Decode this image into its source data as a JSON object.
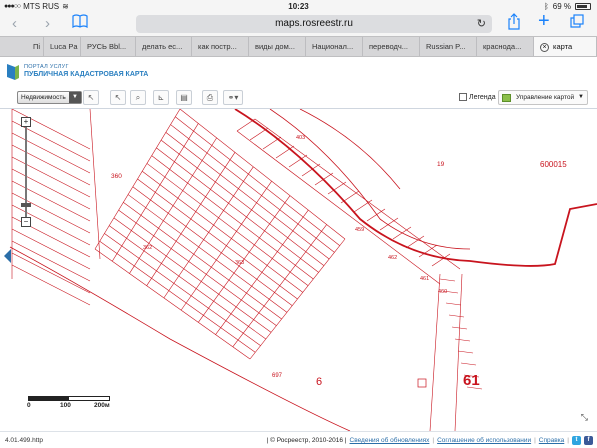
{
  "status_bar": {
    "carrier": "MTS RUS",
    "time": "10:23",
    "battery_text": "69 %",
    "battery_level": 0.69
  },
  "browser": {
    "url": "maps.rosreestr.ru",
    "tabs": [
      {
        "label": "Пі"
      },
      {
        "label": "Luca Pa"
      },
      {
        "label": "РУСЬ Bbl..."
      },
      {
        "label": "делать ес..."
      },
      {
        "label": "как постр..."
      },
      {
        "label": "виды дом..."
      },
      {
        "label": "Национал..."
      },
      {
        "label": "переводч..."
      },
      {
        "label": "Russian P..."
      },
      {
        "label": "краснода..."
      },
      {
        "label": "карта"
      }
    ]
  },
  "portal": {
    "small_title": "ПОРТАЛ УСЛУГ",
    "big_title": "ПУБЛИЧНАЯ КАДАСТРОВАЯ КАРТА"
  },
  "toolbar": {
    "realty_label": "Недвижимость",
    "legend_label": "Легенда",
    "manage_label": "Управление картой"
  },
  "map": {
    "labels": {
      "l360": "360",
      "l19": "19",
      "l600015": "600015",
      "l61": "61",
      "l6": "6",
      "l697": "697",
      "l461": "461",
      "l462": "462",
      "l460": "460",
      "l459": "459",
      "l403": "403",
      "l362": "362",
      "l363": "363"
    },
    "scale": {
      "zero": "0",
      "mid": "100",
      "end": "200м"
    }
  },
  "footer": {
    "version": "4.01.499.http",
    "copyright": "| © Росреестр, 2010-2016 |",
    "links": [
      "Сведения об обновлениях",
      "Соглашение об использовании",
      "Справка"
    ]
  },
  "colors": {
    "parcel_red": "#c8141e",
    "link_blue": "#2a6ea8"
  }
}
